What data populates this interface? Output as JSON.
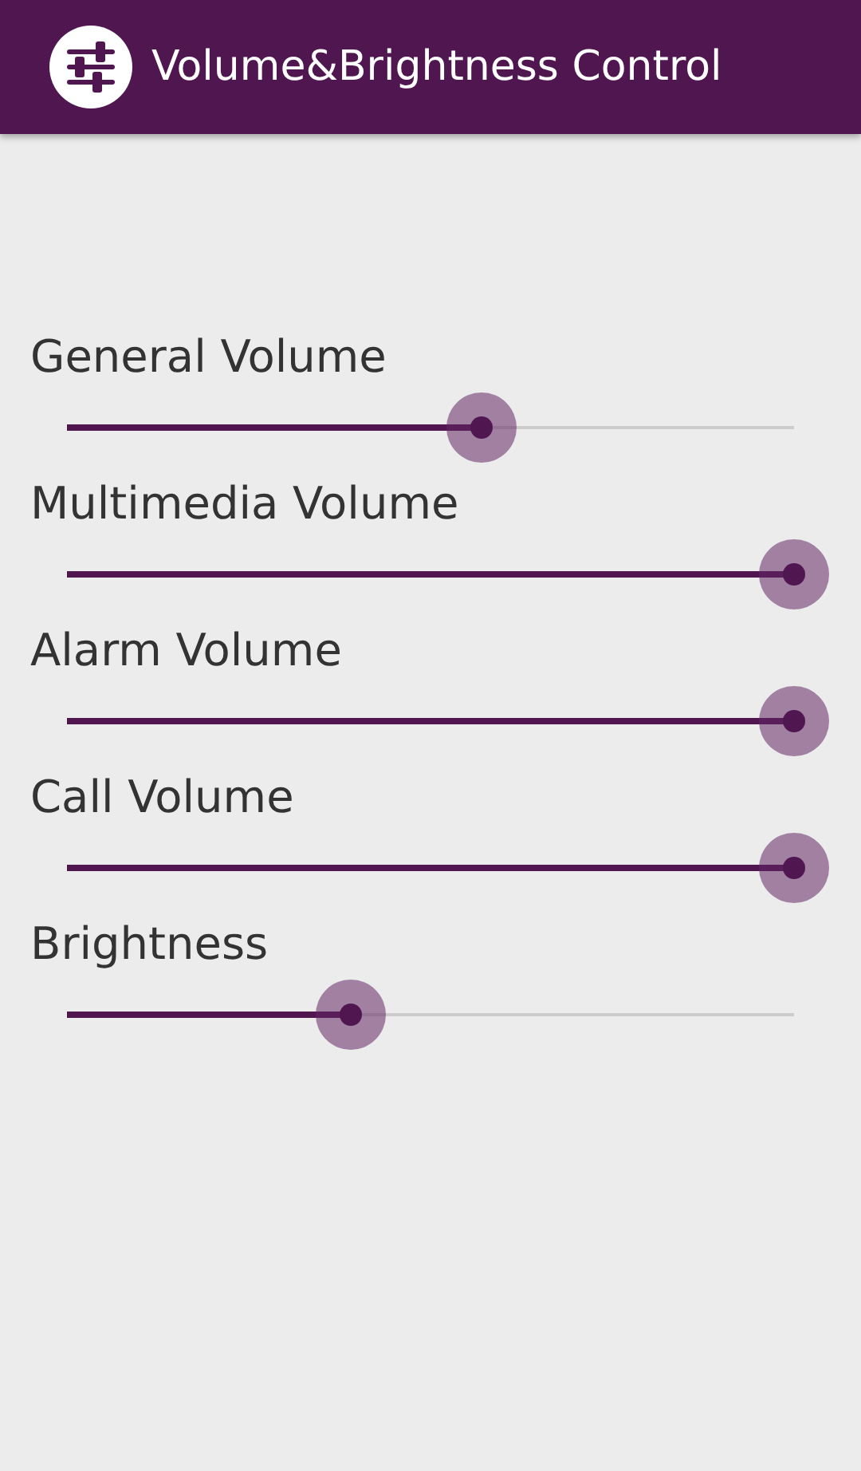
{
  "app_bar": {
    "title": "Volume&Brightness Control"
  },
  "sliders": [
    {
      "label": "General Volume",
      "level": 0.57
    },
    {
      "label": "Multimedia Volume",
      "level": 1
    },
    {
      "label": "Alarm Volume",
      "level": 1
    },
    {
      "label": "Call Volume",
      "level": 1
    },
    {
      "label": "Brightness",
      "level": 0.39
    }
  ]
}
